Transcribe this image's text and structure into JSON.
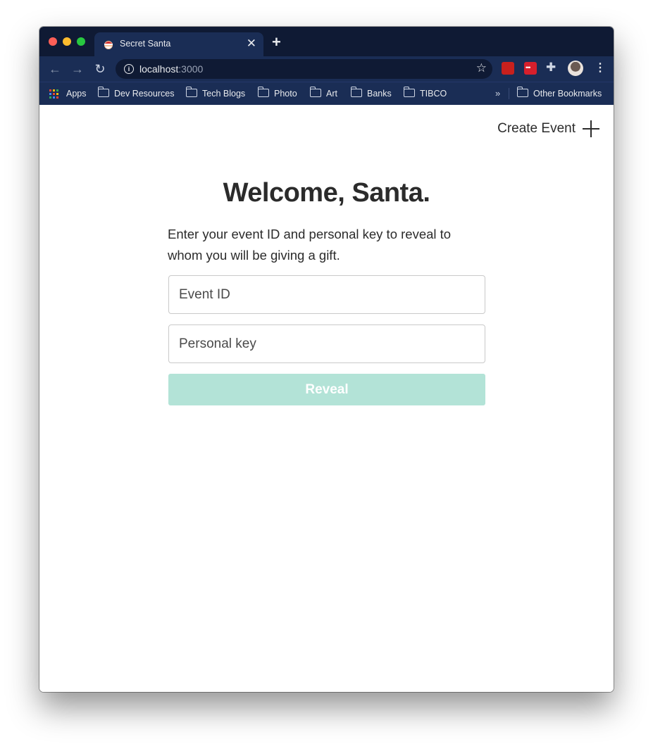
{
  "browser": {
    "tab_title": "Secret Santa",
    "url_host": "localhost",
    "url_port": ":3000",
    "bookmarks": {
      "apps": "Apps",
      "items": [
        "Dev Resources",
        "Tech Blogs",
        "Photo",
        "Art",
        "Banks",
        "TIBCO"
      ],
      "other": "Other Bookmarks"
    }
  },
  "page": {
    "create_event_label": "Create Event",
    "title": "Welcome, Santa.",
    "description": "Enter your event ID and personal key to reveal to whom you will be giving a gift.",
    "event_id_placeholder": "Event ID",
    "personal_key_placeholder": "Personal key",
    "reveal_label": "Reveal"
  },
  "colors": {
    "tab_strip": "#0f1a34",
    "toolbar": "#1a2d55",
    "reveal_button": "#b3e3d7",
    "text": "#2b2b2b"
  }
}
